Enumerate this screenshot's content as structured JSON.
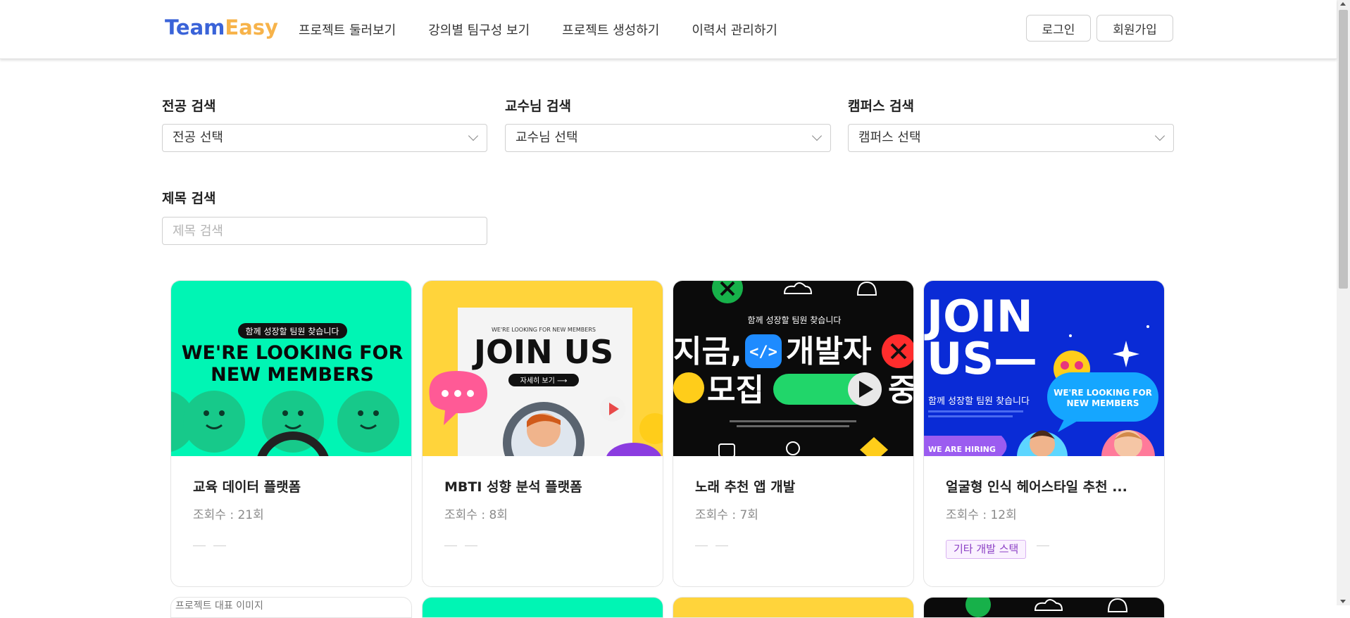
{
  "header": {
    "logo_team": "Team",
    "logo_easy": "Easy",
    "nav": [
      "프로젝트 둘러보기",
      "강의별 팀구성 보기",
      "프로젝트 생성하기",
      "이력서 관리하기"
    ],
    "login_label": "로그인",
    "signup_label": "회원가입"
  },
  "filters": {
    "major": {
      "label": "전공 검색",
      "value": "전공 선택"
    },
    "professor": {
      "label": "교수님 검색",
      "value": "교수님 선택"
    },
    "campus": {
      "label": "캠퍼스 검색",
      "value": "캠퍼스 선택"
    },
    "title": {
      "label": "제목 검색",
      "placeholder": "제목 검색"
    }
  },
  "cards": [
    {
      "title": "교육 데이터 플랫폼",
      "views": "조회수 : 21회",
      "banner": {
        "pill": "함께 성장할 팀원 찾습니다",
        "line1": "WE'RE LOOKING FOR",
        "line2": "NEW MEMBERS"
      }
    },
    {
      "title": "MBTI 성향 분석 플랫폼",
      "views": "조회수 : 8회",
      "banner": {
        "small": "WE'RE LOOKING FOR NEW MEMBERS",
        "big": "JOIN US",
        "button": "자세히 보기 ⟶"
      }
    },
    {
      "title": "노래 추천 앱 개발",
      "views": "조회수 : 7회",
      "banner": {
        "small": "함께 성장할 팀원 찾습니다",
        "l1a": "지금,",
        "l1b": "개발자",
        "l2a": "모집",
        "l2b": "중"
      }
    },
    {
      "title": "얼굴형 인식 헤어스타일 추천 ...",
      "views": "조회수 : 12회",
      "tag": "기타 개발 스택",
      "banner": {
        "big1": "JOIN",
        "big2": "US—",
        "small": "함께 성장할 팀원 찾습니다",
        "bubble1": "WE'RE LOOKING FOR",
        "bubble2": "NEW MEMBERS",
        "hiring": "WE ARE HIRING"
      }
    }
  ],
  "row2": {
    "alt": "프로젝트 대표 이미지"
  },
  "colors": {
    "brand_blue": "#3a63d8",
    "brand_orange": "#f7b34a",
    "tag_purple": "#8a3ec4"
  }
}
